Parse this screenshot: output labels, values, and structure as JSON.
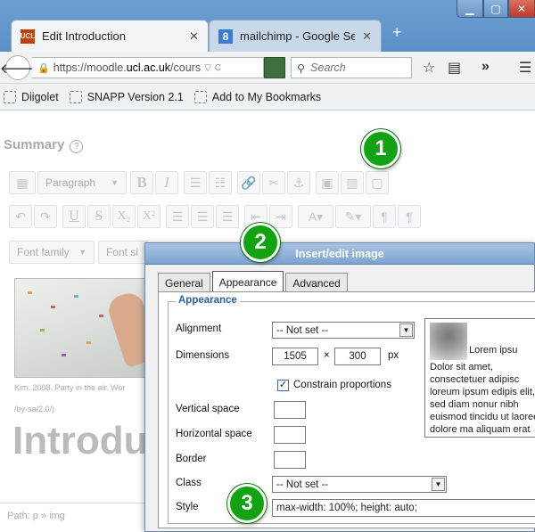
{
  "browser": {
    "tabs": [
      {
        "title": "Edit Introduction",
        "favicon": "UCL"
      },
      {
        "title": "mailchimp - Google Se...",
        "favicon": "8"
      }
    ],
    "new_tab": "+",
    "url_prefix": "https://moodle.",
    "url_domain": "ucl.ac.uk",
    "url_suffix": "/cours",
    "search_placeholder": "Search",
    "bookmarks": [
      "Diigolet",
      "SNAPP Version 2.1",
      "Add to My Bookmarks"
    ]
  },
  "editor": {
    "summary_label": "Summary",
    "help": "?",
    "format_select": "Paragraph",
    "font_family": "Font family",
    "font_size": "Font si",
    "image_credit": "Kim. 2008. Party in the air. Wor",
    "image_credit2": "/by-sa/2.0/)",
    "heading": "Introdu",
    "path": "Path: p » img"
  },
  "dialog": {
    "title": "Insert/edit image",
    "tabs": [
      "General",
      "Appearance",
      "Advanced"
    ],
    "legend": "Appearance",
    "alignment_label": "Alignment",
    "alignment_value": "-- Not set --",
    "dimensions_label": "Dimensions",
    "width": "1505",
    "times": "×",
    "height": "300",
    "unit": "px",
    "constrain_label": "Constrain proportions",
    "vspace_label": "Vertical space",
    "hspace_label": "Horizontal space",
    "border_label": "Border",
    "class_label": "Class",
    "class_value": "-- Not set --",
    "style_label": "Style",
    "style_value": "max-width: 100%; height: auto;",
    "preview_text1": "Lorem ipsu",
    "preview_text2": "Dolor sit amet, consectetuer adipisc loreum ipsum edipis elit, sed diam nonur nibh euismod tincidu ut laoreet dolore ma aliquam erat"
  },
  "markers": [
    "1",
    "2",
    "3"
  ],
  "colors": {
    "marker": "#12a312",
    "titlebar": "#6d9fd2",
    "legend": "#2b5ea8"
  }
}
